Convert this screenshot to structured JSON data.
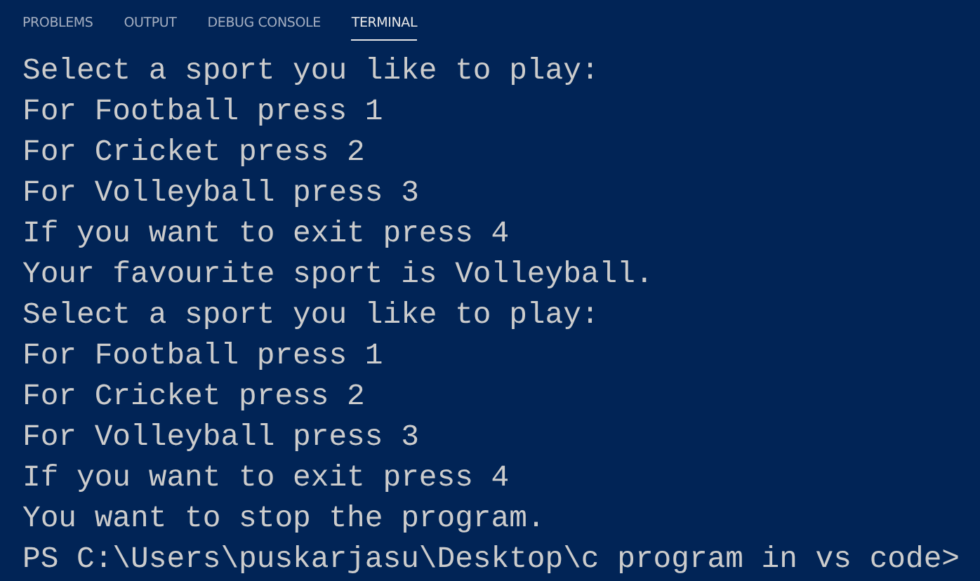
{
  "tabs": [
    {
      "label": "PROBLEMS",
      "selected": false
    },
    {
      "label": "OUTPUT",
      "selected": false
    },
    {
      "label": "DEBUG CONSOLE",
      "selected": false
    },
    {
      "label": "TERMINAL",
      "selected": true
    }
  ],
  "terminal": {
    "lines": [
      "Select a sport you like to play:",
      "For Football press 1",
      "For Cricket press 2",
      "For Volleyball press 3",
      "If you want to exit press 4",
      "Your favourite sport is Volleyball.",
      "Select a sport you like to play:",
      "For Football press 1",
      "For Cricket press 2",
      "For Volleyball press 3",
      "If you want to exit press 4",
      "You want to stop the program.",
      "PS C:\\Users\\puskarjasu\\Desktop\\c program in vs code>"
    ]
  }
}
